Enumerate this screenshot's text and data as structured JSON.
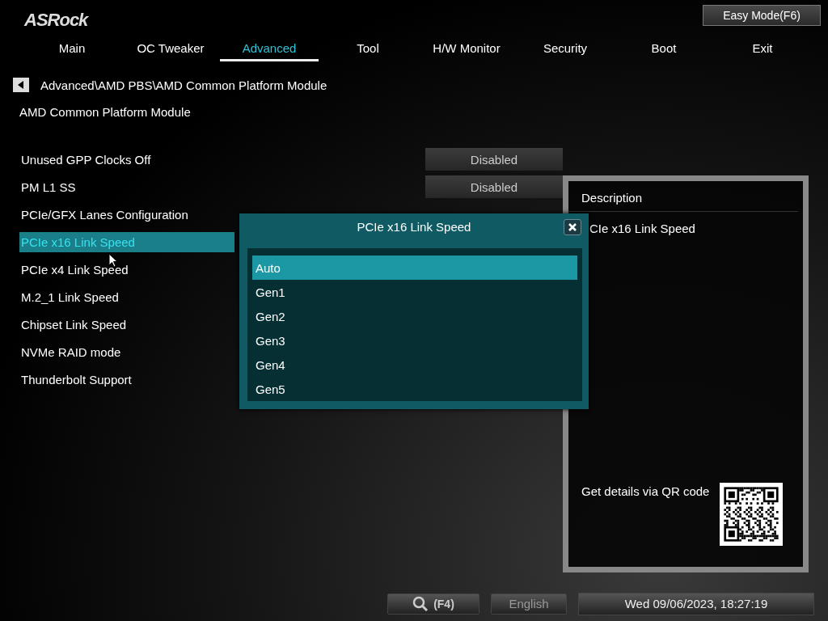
{
  "logo": "ASRock",
  "mode_button": "Easy Mode(F6)",
  "tabs": [
    {
      "label": "Main",
      "selected": false
    },
    {
      "label": "OC Tweaker",
      "selected": false
    },
    {
      "label": "Advanced",
      "selected": true
    },
    {
      "label": "Tool",
      "selected": false
    },
    {
      "label": "H/W Monitor",
      "selected": false
    },
    {
      "label": "Security",
      "selected": false
    },
    {
      "label": "Boot",
      "selected": false
    },
    {
      "label": "Exit",
      "selected": false
    }
  ],
  "breadcrumb": "Advanced\\AMD PBS\\AMD Common Platform Module",
  "page_title": "AMD Common Platform Module",
  "settings": [
    {
      "label": "Unused GPP Clocks Off",
      "value": "Disabled",
      "selected": false
    },
    {
      "label": "PM L1 SS",
      "value": "Disabled",
      "selected": false
    },
    {
      "label": "PCIe/GFX Lanes Configuration",
      "selected": false
    },
    {
      "label": "PCIe x16 Link Speed",
      "selected": true
    },
    {
      "label": "PCIe x4 Link Speed",
      "selected": false
    },
    {
      "label": "M.2_1 Link Speed",
      "selected": false
    },
    {
      "label": "Chipset Link Speed",
      "selected": false
    },
    {
      "label": "NVMe RAID mode",
      "selected": false
    },
    {
      "label": "Thunderbolt Support",
      "selected": false
    }
  ],
  "dialog": {
    "title": "PCIe x16 Link Speed",
    "options": [
      {
        "label": "Auto",
        "selected": true
      },
      {
        "label": "Gen1",
        "selected": false
      },
      {
        "label": "Gen2",
        "selected": false
      },
      {
        "label": "Gen3",
        "selected": false
      },
      {
        "label": "Gen4",
        "selected": false
      },
      {
        "label": "Gen5",
        "selected": false
      }
    ]
  },
  "description": {
    "heading": "Description",
    "text": "CIe x16 Link Speed",
    "qr_text": "Get details via QR code"
  },
  "footer": {
    "search_key": "(F4)",
    "language": "English",
    "datetime": "Wed 09/06/2023, 18:27:19"
  }
}
